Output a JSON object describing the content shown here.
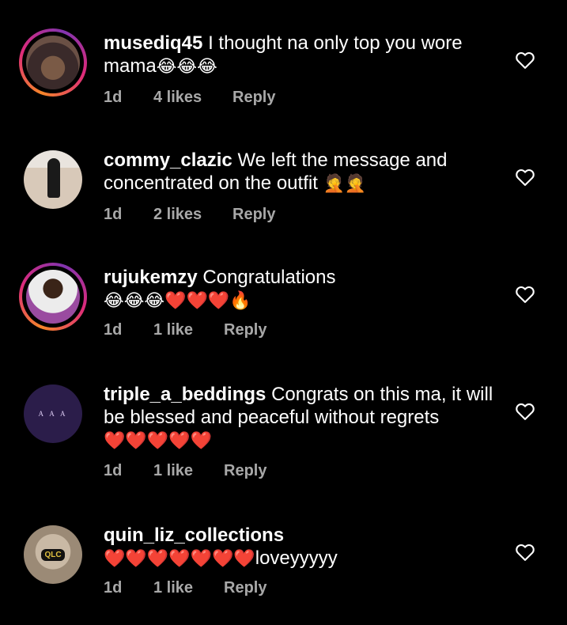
{
  "comments": [
    {
      "username": "musediq45",
      "text": "I thought na only top you wore mama",
      "emojis": "😂😂😂",
      "time": "1d",
      "likes": "4 likes",
      "reply": "Reply",
      "avatar_ring": true
    },
    {
      "username": "commy_clazic",
      "text": "We left the message and concentrated on the outfit",
      "emojis": "🤦🤦",
      "time": "1d",
      "likes": "2 likes",
      "reply": "Reply",
      "avatar_ring": false
    },
    {
      "username": "rujukemzy",
      "text": "Congratulations",
      "emojis": "😂😂😂❤️❤️❤️🔥",
      "time": "1d",
      "likes": "1 like",
      "reply": "Reply",
      "avatar_ring": true
    },
    {
      "username": "triple_a_beddings",
      "text": "Congrats on this ma, it will be blessed and peaceful without regrets",
      "emojis": "❤️❤️❤️❤️❤️",
      "time": "1d",
      "likes": "1 like",
      "reply": "Reply",
      "avatar_ring": false,
      "avatar_logo": "A A A"
    },
    {
      "username": "quin_liz_collections",
      "text": "",
      "emojis": "❤️❤️❤️❤️❤️❤️❤️",
      "suffix": "loveyyyyy",
      "time": "1d",
      "likes": "1 like",
      "reply": "Reply",
      "avatar_ring": false,
      "avatar_logo": "QLC"
    }
  ],
  "icons": {
    "like": "heart-outline-icon"
  },
  "colors": {
    "background": "#000000",
    "text": "#ffffff",
    "meta": "#a8a8a8",
    "emoji_red": "#e0262e"
  }
}
